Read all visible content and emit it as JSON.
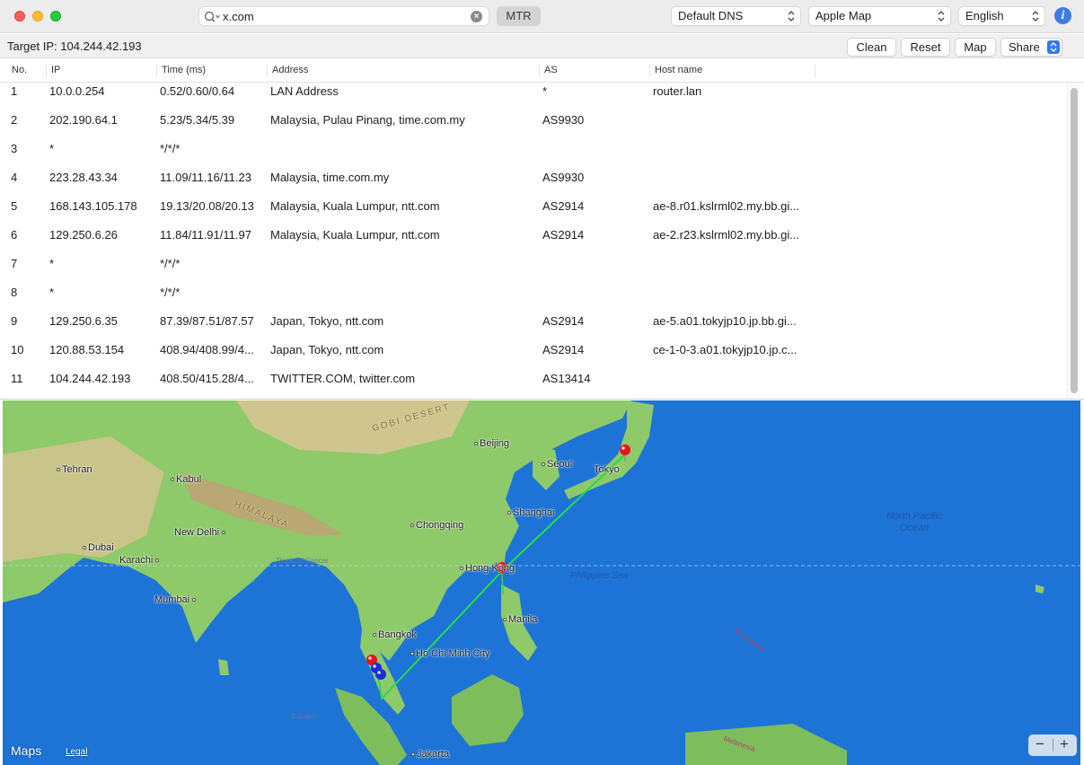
{
  "window": {
    "search_value": "x.com",
    "mtr_label": "MTR",
    "dns_select": "Default DNS",
    "map_select": "Apple Map",
    "language_select": "English",
    "info_icon": "i"
  },
  "toolbar": {
    "target_label": "Target IP:",
    "target_ip": "104.244.42.193",
    "clean_label": "Clean",
    "reset_label": "Reset",
    "map_label": "Map",
    "share_label": "Share"
  },
  "table": {
    "headers": [
      "No.",
      "IP",
      "Time (ms)",
      "Address",
      "AS",
      "Host name"
    ],
    "rows": [
      {
        "no": "1",
        "ip": "10.0.0.254",
        "time": "0.52/0.60/0.64",
        "address": "LAN Address",
        "as": "*",
        "host": "router.lan"
      },
      {
        "no": "2",
        "ip": "202.190.64.1",
        "time": "5.23/5.34/5.39",
        "address": "Malaysia, Pulau Pinang, time.com.my",
        "as": "AS9930",
        "host": ""
      },
      {
        "no": "3",
        "ip": "*",
        "time": "*/*/*",
        "address": "",
        "as": "",
        "host": ""
      },
      {
        "no": "4",
        "ip": "223.28.43.34",
        "time": "11.09/11.16/11.23",
        "address": "Malaysia, time.com.my",
        "as": "AS9930",
        "host": ""
      },
      {
        "no": "5",
        "ip": "168.143.105.178",
        "time": "19.13/20.08/20.13",
        "address": "Malaysia, Kuala Lumpur, ntt.com",
        "as": "AS2914",
        "host": "ae-8.r01.kslrml02.my.bb.gi..."
      },
      {
        "no": "6",
        "ip": "129.250.6.26",
        "time": "11.84/11.91/11.97",
        "address": "Malaysia, Kuala Lumpur, ntt.com",
        "as": "AS2914",
        "host": "ae-2.r23.kslrml02.my.bb.gi..."
      },
      {
        "no": "7",
        "ip": "*",
        "time": "*/*/*",
        "address": "",
        "as": "",
        "host": ""
      },
      {
        "no": "8",
        "ip": "*",
        "time": "*/*/*",
        "address": "",
        "as": "",
        "host": ""
      },
      {
        "no": "9",
        "ip": "129.250.6.35",
        "time": "87.39/87.51/87.57",
        "address": "Japan, Tokyo, ntt.com",
        "as": "AS2914",
        "host": "ae-5.a01.tokyjp10.jp.bb.gi..."
      },
      {
        "no": "10",
        "ip": "120.88.53.154",
        "time": "408.94/408.99/4...",
        "address": "Japan, Tokyo, ntt.com",
        "as": "AS2914",
        "host": "ce-1-0-3.a01.tokyjp10.jp.c..."
      },
      {
        "no": "11",
        "ip": "104.244.42.193",
        "time": "408.50/415.28/4...",
        "address": "TWITTER.COM, twitter.com",
        "as": "AS13414",
        "host": ""
      }
    ]
  },
  "map": {
    "cities": [
      "Beijing",
      "Seoul",
      "Tokyo",
      "Tehran",
      "Kabul",
      "Chongqing",
      "Shanghai",
      "New Delhi",
      "Dubai",
      "Karachi",
      "Hong Kong",
      "Mumbai",
      "Manila",
      "Bangkok",
      "Ho Chi Minh City",
      "Jakarta"
    ],
    "regions": [
      "GOBI DESERT",
      "HIMALAYA"
    ],
    "oceans": [
      "North Pacific Ocean",
      "Philippine Sea"
    ],
    "notes": [
      "Tropic of Cancer",
      "Equator",
      "Micronesia",
      "Melanesia"
    ],
    "logo": "Maps",
    "legal": "Legal",
    "zoom_out": "−",
    "zoom_in": "+",
    "colors": {
      "ocean": "#1e73d6",
      "land": "#8ec96a",
      "route": "#2bd84a",
      "pin_red": "#e8141a",
      "pin_blue": "#1a2cdf"
    }
  }
}
